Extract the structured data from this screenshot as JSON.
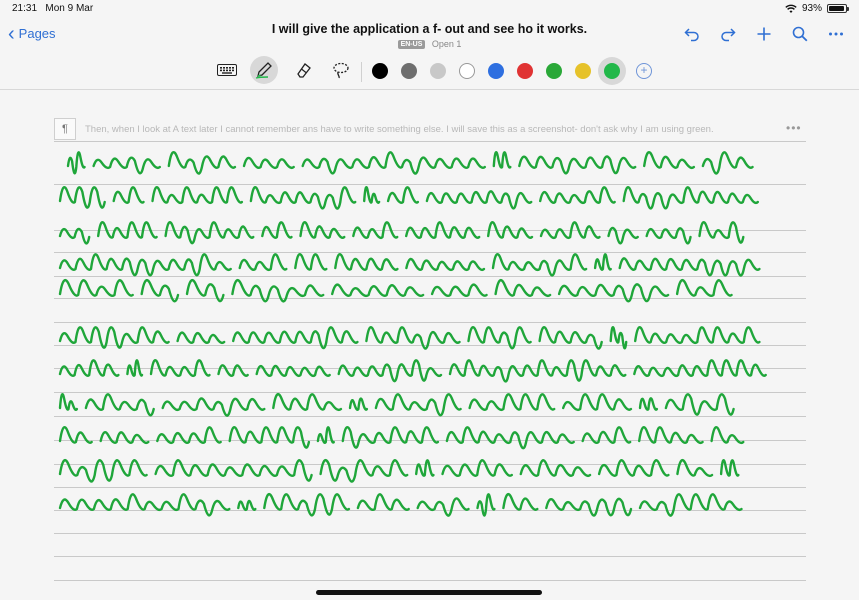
{
  "status_bar": {
    "time": "21:31",
    "date": "Mon 9 Mar",
    "battery": "93%",
    "battery_level": 0.93
  },
  "nav": {
    "back_label": "Pages",
    "title": "I will give the application a f- out and see ho it works.",
    "language_badge": "EN-US",
    "open_label": "Open 1",
    "accent_color": "#2f6fd3"
  },
  "toolbar": {
    "tools": [
      "keyboard-icon",
      "pen-icon",
      "eraser-icon",
      "lasso-icon"
    ],
    "active_tool": "pen-icon",
    "colors": [
      "#000000",
      "#6e6e6e",
      "#c8c8c8",
      "#ffffff",
      "#2e6fe0",
      "#e03333",
      "#2aa838",
      "#e6c22a",
      "#22b84a"
    ],
    "selected_color": "#22b84a",
    "add_color_label": "+"
  },
  "document": {
    "paragraph_marker": "¶",
    "converted_text": "Then, when I look at A text later I cannot remember ans have to write something else. I will save this as a screenshot- don't ask why I am using green.",
    "more_label": "•••",
    "ink_color": "#1fa63a",
    "handwritten_lines": [
      "I will give the application a try-out and see",
      "how it works. Indeed, I am writing these sentences",
      "in Nebo (oddly it did not catch the name of the app",
      "correctly), and as with other errors I sometimes",
      "have to go back, erase and try again. The",
      "results are slightly better than when I dictate:",
      "then I have to check through immediately, otherwise",
      "I will forget what I said. Then, when I look",
      "at the text later I cannot remember and have to",
      "write something else. I will save this as a",
      "screenshot — don't ask why I am using green."
    ]
  }
}
